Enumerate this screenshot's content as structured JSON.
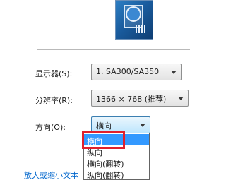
{
  "display": {
    "label": "显示器(S):",
    "value": "1. SA300/SA350"
  },
  "resolution": {
    "label": "分辨率(R):",
    "value": "1366 × 768 (推荐)"
  },
  "orientation": {
    "label": "方向(O):",
    "value": "横向",
    "options": [
      "横向",
      "纵向",
      "横向(翻转)",
      "纵向(翻转)"
    ]
  },
  "link": {
    "text": "放大或缩小文本"
  },
  "colors": {
    "highlight": "#e0202c",
    "selection": "#3399ff",
    "link": "#0066cc"
  }
}
